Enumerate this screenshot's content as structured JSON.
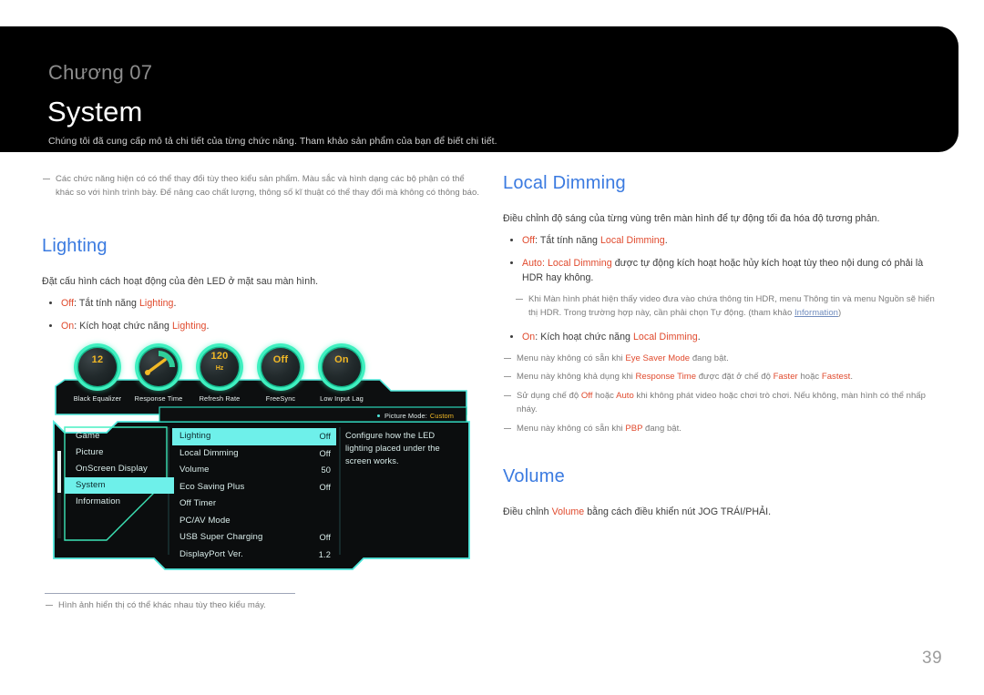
{
  "header": {
    "chapter": "Chương 07",
    "title": "System",
    "subtitle": "Chúng tôi đã cung cấp mô tả chi tiết của từng chức năng. Tham khảo sản phẩm của bạn để biết chi tiết."
  },
  "left": {
    "intro_note": "Các chức năng hiện có có thể thay đổi tùy theo kiểu sản phẩm. Màu sắc và hình dạng các bộ phận có thể khác so với hình trình bày. Để nâng cao chất lượng, thông số kĩ thuật có thể thay đổi mà không có thông báo.",
    "lighting": {
      "heading": "Lighting",
      "intro": "Đặt cấu hình cách hoạt động của đèn LED ở mặt sau màn hình.",
      "bullets": [
        {
          "key": "Off",
          "sep": ": Tắt tính năng ",
          "term": "Lighting",
          "tail": "."
        },
        {
          "key": "On",
          "sep": ": Kích hoạt chức năng ",
          "term": "Lighting",
          "tail": "."
        }
      ]
    },
    "footnote": "Hình ảnh hiển thị có thể khác nhau tùy theo kiểu máy."
  },
  "right": {
    "local_dimming": {
      "heading": "Local Dimming",
      "intro": "Điều chỉnh độ sáng của từng vùng trên màn hình để tự động tối đa hóa độ tương phản.",
      "bullets": [
        {
          "key": "Off",
          "sep": ": Tắt tính năng ",
          "term": "Local Dimming",
          "tail": "."
        },
        {
          "key": "Auto: Local Dimming",
          "sep": " được tự động kích hoạt hoặc hủy kích hoạt tùy theo nội dung có phải là HDR hay không.",
          "term": "",
          "tail": ""
        },
        {
          "key": "On",
          "sep": ": Kích hoạt chức năng ",
          "term": "Local Dimming",
          "tail": "."
        }
      ],
      "auto_note_pre": "Khi Màn hình phát hiện thấy video đưa vào chứa thông tin HDR, menu Thông tin và menu Nguồn sẽ hiển thị HDR. Trong trường hợp này, cần phải chọn Tự động. (tham khảo ",
      "auto_note_link": "Information",
      "auto_note_post": ")",
      "notes": [
        {
          "pre": "Menu này không có sẵn khi ",
          "hl1": "Eye Saver Mode",
          "mid": " đang bật.",
          "hl2": "",
          "post": ""
        },
        {
          "pre": "Menu này không khả dụng khi ",
          "hl1": "Response Time",
          "mid": " được đặt ở chế độ ",
          "hl2": "Faster",
          "post": " hoặc ",
          "hl3": "Fastest",
          "post2": "."
        },
        {
          "pre": "Sử dụng chế độ ",
          "hl1": "Off",
          "mid": " hoặc ",
          "hl2": "Auto",
          "post": " khi không phát video hoặc chơi trò chơi. Nếu không, màn hình có thể nhấp nháy.",
          "post2": ""
        },
        {
          "pre": "Menu này không có sẵn khi ",
          "hl1": "PBP",
          "mid": " đang bật.",
          "hl2": "",
          "post": ""
        }
      ]
    },
    "volume": {
      "heading": "Volume",
      "pre": "Điều chỉnh ",
      "term": "Volume",
      "post": " bằng cách điều khiển nút JOG TRÁI/PHẢI."
    }
  },
  "osd": {
    "gauges": [
      {
        "label": "Black Equalizer",
        "value": "12",
        "unit": "",
        "type": "value"
      },
      {
        "label": "Response Time",
        "value": "",
        "unit": "",
        "type": "needle"
      },
      {
        "label": "Refresh Rate",
        "value": "120",
        "unit": "Hz",
        "type": "value-unit"
      },
      {
        "label": "FreeSync",
        "value": "Off",
        "unit": "",
        "type": "value"
      },
      {
        "label": "Low Input Lag",
        "value": "On",
        "unit": "",
        "type": "value"
      }
    ],
    "picture_mode_label": "Picture Mode:",
    "picture_mode_value": "Custom",
    "nav": [
      {
        "label": "Game",
        "selected": false
      },
      {
        "label": "Picture",
        "selected": false
      },
      {
        "label": "OnScreen Display",
        "selected": false
      },
      {
        "label": "System",
        "selected": true
      },
      {
        "label": "Information",
        "selected": false
      }
    ],
    "settings": [
      {
        "label": "Lighting",
        "value": "Off",
        "selected": true
      },
      {
        "label": "Local Dimming",
        "value": "Off",
        "selected": false
      },
      {
        "label": "Volume",
        "value": "50",
        "selected": false
      },
      {
        "label": "Eco Saving Plus",
        "value": "Off",
        "selected": false
      },
      {
        "label": "Off Timer",
        "value": "",
        "selected": false
      },
      {
        "label": "PC/AV Mode",
        "value": "",
        "selected": false
      },
      {
        "label": "USB Super Charging",
        "value": "Off",
        "selected": false
      },
      {
        "label": "DisplayPort Ver.",
        "value": "1.2",
        "selected": false
      }
    ],
    "description": "Configure how the LED lighting placed under the screen works."
  },
  "page_number": "39"
}
